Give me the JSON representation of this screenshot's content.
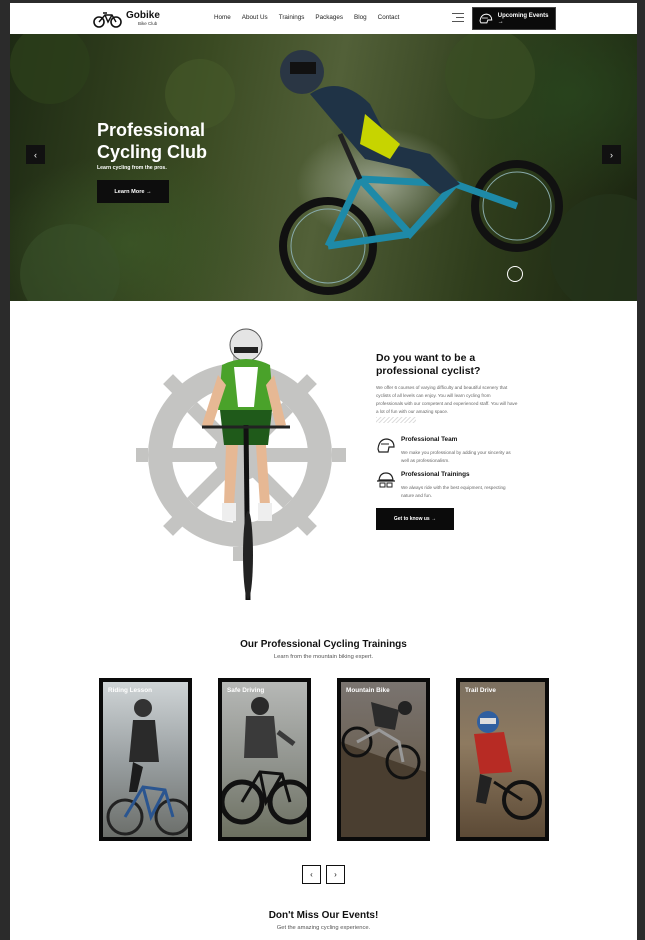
{
  "header": {
    "logo_name": "Gobike",
    "logo_sub": "Bike Club",
    "nav": [
      "Home",
      "About Us",
      "Trainings",
      "Packages",
      "Blog",
      "Contact"
    ],
    "events_button": "Upcoming Events →"
  },
  "hero": {
    "title": "Professional Cycling Club",
    "subtitle": "Learn cycling from the pros.",
    "button": "Learn More →",
    "prev_icon": "‹",
    "next_icon": "›"
  },
  "about": {
    "title": "Do you want to be a professional cyclist?",
    "description": "We offer 6 courses of varying difficulty and beautiful scenery that cyclists of all levels can enjoy. You will learn cycling from professionals with our competent and experienced staff. You will have a lot of fun with our amazing space.",
    "features": [
      {
        "title": "Professional Team",
        "text": "We make you professional by adding your sincerity as well as professionalism.",
        "icon": "helmet-icon"
      },
      {
        "title": "Professional Trainings",
        "text": "We always ride with the best equipment, respecting nature and fun.",
        "icon": "trainer-icon"
      }
    ],
    "button": "Get to know us →"
  },
  "trainings": {
    "title": "Our Professional Cycling Trainings",
    "subtitle": "Learn from the mountain biking expert.",
    "cards": [
      {
        "label": "Riding Lesson"
      },
      {
        "label": "Safe Driving"
      },
      {
        "label": "Mountain Bike"
      },
      {
        "label": "Trail Drive"
      }
    ],
    "prev": "‹",
    "next": "›"
  },
  "events": {
    "title": "Don't Miss Our Events!",
    "subtitle": "Get the amazing cycling experience."
  },
  "colors": {
    "primary": "#0b0b0b",
    "text_muted": "#666666",
    "background": "#ffffff"
  }
}
